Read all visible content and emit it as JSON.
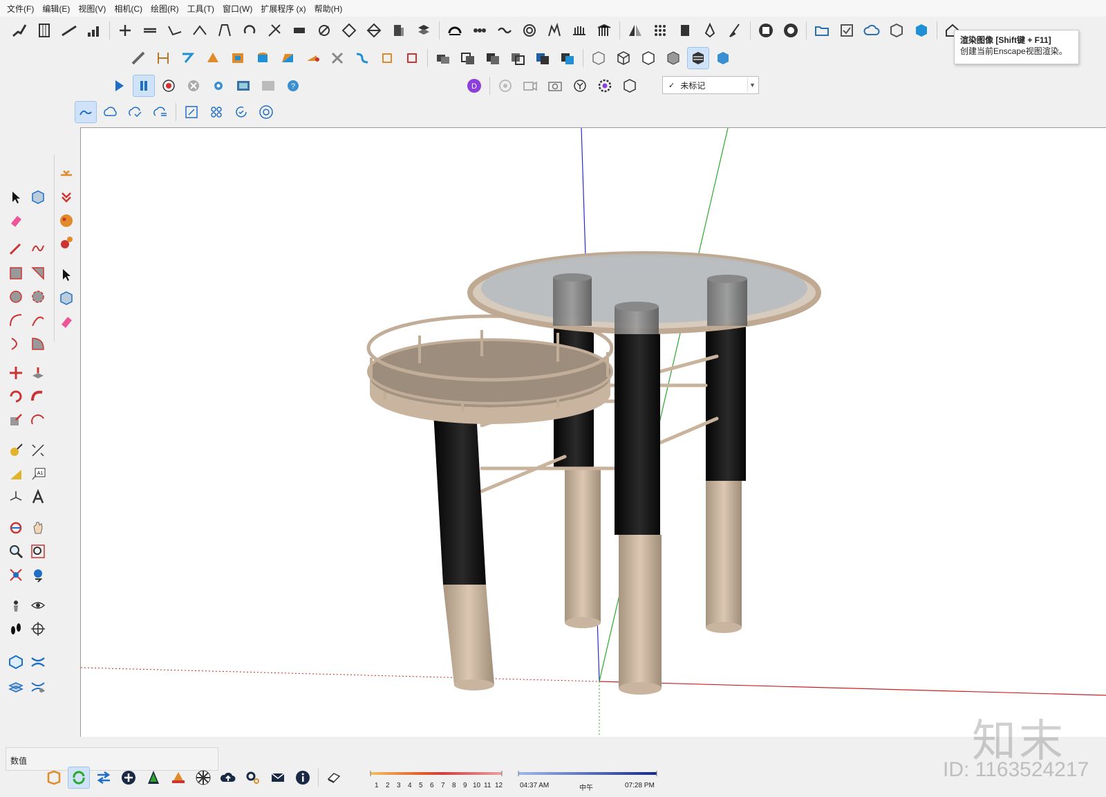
{
  "menubar": {
    "items": [
      "文件(F)",
      "编辑(E)",
      "视图(V)",
      "相机(C)",
      "绘图(R)",
      "工具(T)",
      "窗口(W)",
      "扩展程序 (x)",
      "帮助(H)"
    ]
  },
  "tooltip": {
    "title": "渲染图像 [Shift键 + F11]",
    "description": "创建当前Enscape视图渲染。"
  },
  "tag_select": {
    "value": "未标记",
    "check": "✓"
  },
  "status": {
    "value_label": "数值"
  },
  "shadow": {
    "hours": [
      "1",
      "2",
      "3",
      "4",
      "5",
      "6",
      "7",
      "8",
      "9",
      "10",
      "11",
      "12"
    ],
    "time_start": "04:37 AM",
    "time_mid": "中午",
    "time_end": "07:28 PM"
  },
  "watermark": {
    "logo": "知末",
    "id": "ID: 1163524217"
  },
  "colors": {
    "glass": "#b8bcc0",
    "leg_dark": "#141414",
    "leg_light": "#cdb8a1",
    "tray": "#9d8d7c",
    "rim": "#c2ad98",
    "axis_red": "#cc2222",
    "axis_green": "#22aa22",
    "axis_blue": "#2222cc"
  }
}
